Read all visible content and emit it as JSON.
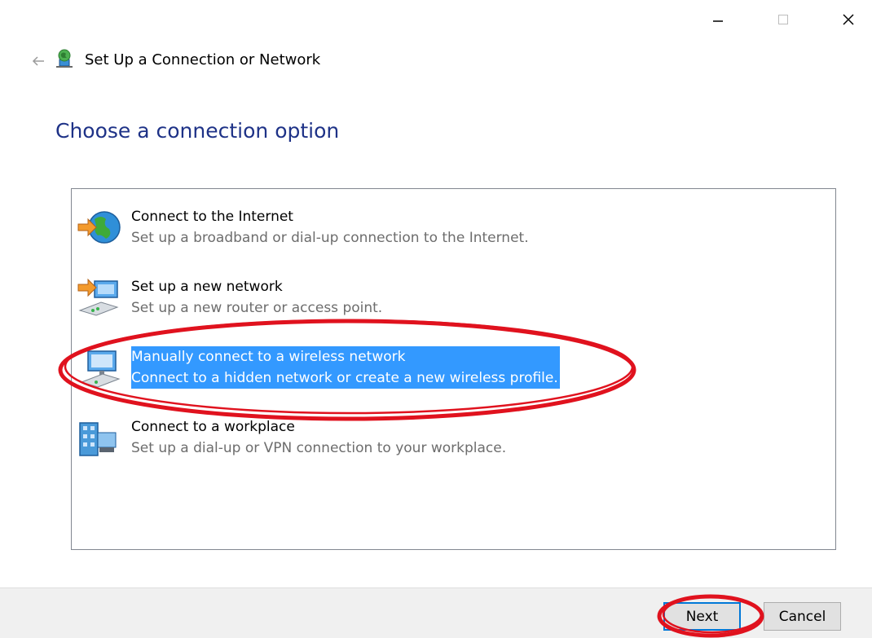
{
  "window": {
    "title": "Set Up a Connection or Network",
    "caption_icons": [
      "minimize-icon",
      "maximize-icon",
      "close-icon"
    ]
  },
  "header": {
    "back_icon": "back-arrow-icon",
    "app_icon": "network-globe-icon"
  },
  "page": {
    "heading": "Choose a connection option"
  },
  "options": [
    {
      "title": "Connect to the Internet",
      "description": "Set up a broadband or dial-up connection to the Internet.",
      "icon": "internet-globe-icon",
      "selected": false
    },
    {
      "title": "Set up a new network",
      "description": "Set up a new router or access point.",
      "icon": "router-network-icon",
      "selected": false
    },
    {
      "title": "Manually connect to a wireless network",
      "description": "Connect to a hidden network or create a new wireless profile.",
      "icon": "wireless-monitor-icon",
      "selected": true
    },
    {
      "title": "Connect to a workplace",
      "description": "Set up a dial-up or VPN connection to your workplace.",
      "icon": "workplace-building-icon",
      "selected": false
    }
  ],
  "footer": {
    "next_label": "Next",
    "cancel_label": "Cancel"
  },
  "colors": {
    "heading": "#1e3287",
    "selection": "#3399ff",
    "annotation": "#e0121e",
    "description": "#6d6d6d"
  }
}
